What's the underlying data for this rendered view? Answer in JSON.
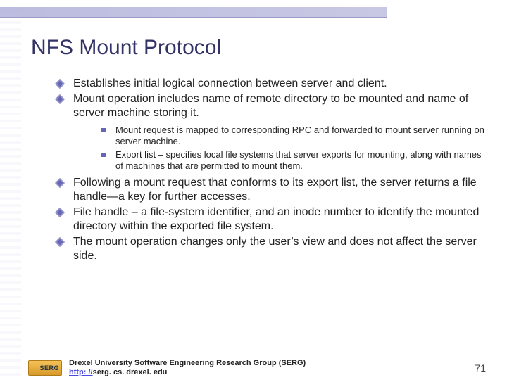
{
  "title": "NFS Mount Protocol",
  "bullets": {
    "b0": "Establishes initial logical connection between server and client.",
    "b1": "Mount operation includes name of remote directory to be mounted and name of server machine storing it.",
    "b1s0": "Mount request is mapped to corresponding RPC and forwarded to mount server running on server machine.",
    "b1s1": "Export list – specifies local file systems that server exports for mounting, along with names of machines that are permitted to mount them.",
    "b2": "Following a mount request that conforms to its export list, the server returns a file handle—a key for further accesses.",
    "b3": "File handle – a file-system identifier, and an inode number to identify the mounted directory within the exported file system.",
    "b4": "The mount operation changes only the user’s view and does not affect the server side."
  },
  "footer": {
    "logo_label": "SERG",
    "org": "Drexel University Software Engineering Research Group (SERG)",
    "link_prefix": "http: //",
    "link_tail": "serg. cs. drexel. edu"
  },
  "page_number": "71"
}
